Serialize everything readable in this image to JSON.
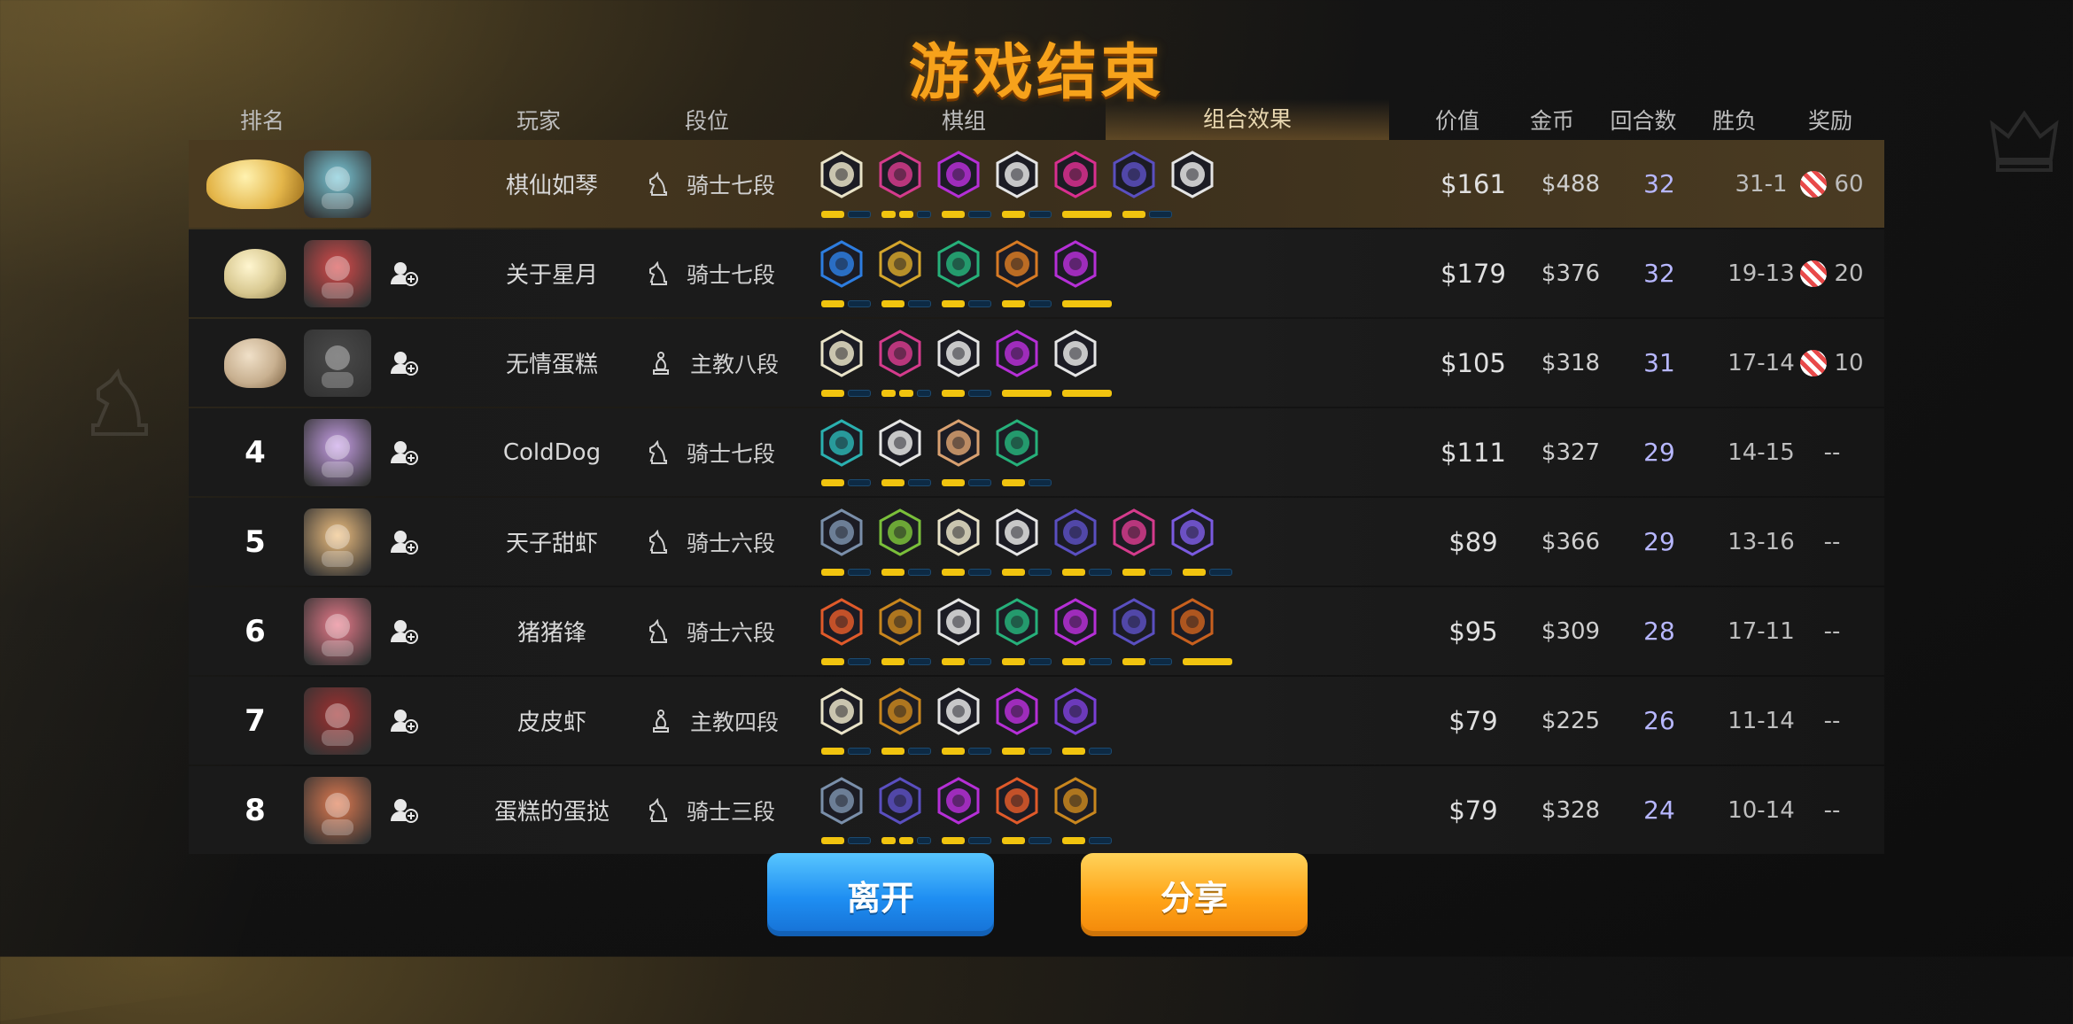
{
  "title": "游戏结束",
  "headers": {
    "rank": "排名",
    "player": "玩家",
    "grade": "段位",
    "pieces": "棋组",
    "combo": "组合效果",
    "value": "价值",
    "gold": "金币",
    "rounds": "回合数",
    "win_loss": "胜负",
    "reward": "奖励"
  },
  "rows": [
    {
      "rank": "",
      "medal": "gold",
      "name": "棋仙如琴",
      "grade": "骑士七段",
      "grade_icon": "knight-icon",
      "value": "$161",
      "gold": "$488",
      "rounds": "32",
      "win_loss": "31-1",
      "reward": "60",
      "has_candy": true,
      "add_friend": false,
      "pieces": [
        "#e9e3c8",
        "#d43b8c",
        "#b52fd6",
        "#e5e5e5",
        "#d92f8f",
        "#5a4fc0",
        "#e5e5e5"
      ],
      "bars": [
        2,
        3,
        2,
        2,
        1,
        2
      ]
    },
    {
      "rank": "",
      "medal": "silver",
      "name": "关于星月",
      "grade": "骑士七段",
      "grade_icon": "knight-icon",
      "value": "$179",
      "gold": "$376",
      "rounds": "32",
      "win_loss": "19-13",
      "reward": "20",
      "has_candy": true,
      "add_friend": true,
      "pieces": [
        "#2d7de0",
        "#d4a52c",
        "#26b07a",
        "#d77a24",
        "#b52fd6"
      ],
      "bars": [
        2,
        2,
        2,
        2,
        1
      ]
    },
    {
      "rank": "",
      "medal": "bronze",
      "name": "无情蛋糕",
      "grade": "主教八段",
      "grade_icon": "bishop-icon",
      "value": "$105",
      "gold": "$318",
      "rounds": "31",
      "win_loss": "17-14",
      "reward": "10",
      "has_candy": true,
      "add_friend": true,
      "pieces": [
        "#e9e3c8",
        "#d43b8c",
        "#e5e5e5",
        "#b52fd6",
        "#e5e5e5"
      ],
      "bars": [
        2,
        3,
        2,
        1,
        1
      ]
    },
    {
      "rank": "4",
      "medal": "",
      "name": "ColdDog",
      "grade": "骑士七段",
      "grade_icon": "knight-icon",
      "value": "$111",
      "gold": "$327",
      "rounds": "29",
      "win_loss": "14-15",
      "reward": "--",
      "has_candy": false,
      "add_friend": true,
      "pieces": [
        "#2ab0b0",
        "#e5e5e5",
        "#d8a070",
        "#26b07a"
      ],
      "bars": [
        2,
        2,
        2,
        2
      ]
    },
    {
      "rank": "5",
      "medal": "",
      "name": "天子甜虾",
      "grade": "骑士六段",
      "grade_icon": "knight-icon",
      "value": "$89",
      "gold": "$366",
      "rounds": "29",
      "win_loss": "13-16",
      "reward": "--",
      "has_candy": false,
      "add_friend": true,
      "pieces": [
        "#7a8faa",
        "#7abf3a",
        "#e9e3c8",
        "#e5e5e5",
        "#5a4fc0",
        "#d43b8c",
        "#7a5ae0"
      ],
      "bars": [
        2,
        2,
        2,
        2,
        2,
        2,
        2
      ]
    },
    {
      "rank": "6",
      "medal": "",
      "name": "猪猪锋",
      "grade": "骑士六段",
      "grade_icon": "knight-icon",
      "value": "$95",
      "gold": "$309",
      "rounds": "28",
      "win_loss": "17-11",
      "reward": "--",
      "has_candy": false,
      "add_friend": true,
      "pieces": [
        "#e05a2a",
        "#c8861e",
        "#e5e5e5",
        "#26b07a",
        "#b52fd6",
        "#5a4fc0",
        "#c8601e"
      ],
      "bars": [
        2,
        2,
        2,
        2,
        2,
        2,
        1
      ]
    },
    {
      "rank": "7",
      "medal": "",
      "name": "皮皮虾",
      "grade": "主教四段",
      "grade_icon": "bishop-icon",
      "value": "$79",
      "gold": "$225",
      "rounds": "26",
      "win_loss": "11-14",
      "reward": "--",
      "has_candy": false,
      "add_friend": true,
      "pieces": [
        "#e9e3c8",
        "#c8861e",
        "#e5e5e5",
        "#b52fd6",
        "#7a3fd6"
      ],
      "bars": [
        2,
        2,
        2,
        2,
        2
      ]
    },
    {
      "rank": "8",
      "medal": "",
      "name": "蛋糕的蛋挞",
      "grade": "骑士三段",
      "grade_icon": "knight-icon",
      "value": "$79",
      "gold": "$328",
      "rounds": "24",
      "win_loss": "10-14",
      "reward": "--",
      "has_candy": false,
      "add_friend": true,
      "pieces": [
        "#7a8faa",
        "#5a4fc0",
        "#b52fd6",
        "#e05a2a",
        "#c8861e"
      ],
      "bars": [
        2,
        3,
        2,
        2,
        2
      ]
    }
  ],
  "buttons": {
    "leave": "离开",
    "share": "分享"
  },
  "colors": {
    "title": "#f7a21b",
    "bar_on": "#f1c40f",
    "bar_off": "#0d2a44",
    "rounds_text": "#b7b7ff"
  }
}
